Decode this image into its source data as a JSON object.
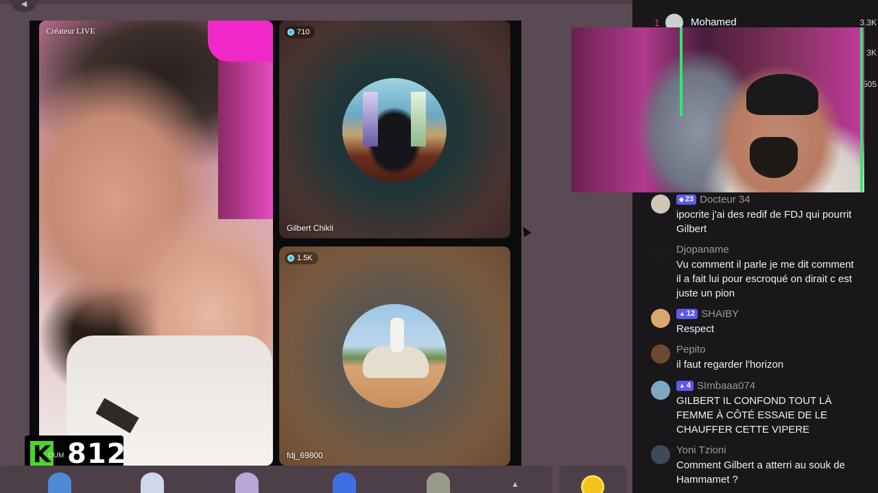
{
  "top": {
    "back_glyph": "◀"
  },
  "grid": {
    "main": {
      "label": "Créateur LIVE"
    },
    "top": {
      "viewers": "710",
      "name": "Gilbert Chikli"
    },
    "bottom": {
      "viewers": "1.5K",
      "name": "fdj_69800"
    }
  },
  "counter": {
    "logo": "K",
    "value": "812",
    "sub": "OUM"
  },
  "chat": {
    "ranking": {
      "rank": "1",
      "name": "Mohamed",
      "value": "3.3K",
      "value2": "3K",
      "value3": "505"
    },
    "messages": [
      {
        "level": "23",
        "badge_symbol": "◆",
        "user": "Docteur 34",
        "text": "ipocrite j'ai des redif de FDJ qui pourrit Gilbert",
        "avatar_color": "#cfc6b8"
      },
      {
        "level": "",
        "badge_symbol": "",
        "user": "Djopaname",
        "text": "Vu comment il parle je me dit comment il a fait lui pour escroqué on dirait c est juste un pion",
        "avatar_color": "#1a181b"
      },
      {
        "level": "12",
        "badge_symbol": "▲",
        "user": "SHAïBY",
        "text": "Respect",
        "avatar_color": "#d9a96b"
      },
      {
        "level": "",
        "badge_symbol": "",
        "user": "Pepito",
        "text": "il faut regarder l'horizon",
        "avatar_color": "#6b4a2f"
      },
      {
        "level": "4",
        "badge_symbol": "▲",
        "user": "SImbaaa074",
        "text": "GILBERT IL CONFOND TOUT LÀ FEMME À CÔTÉ ESSAIE DE LE CHAUFFER CETTE VIPERE",
        "avatar_color": "#7fa6c2"
      },
      {
        "level": "",
        "badge_symbol": "",
        "user": "Yoni Tzioni",
        "text": "Comment Gilbert a atterri au souk de Hammamet ?",
        "avatar_color": "#3c4a5a"
      }
    ]
  },
  "colors": {
    "accent_badge": "#5d5ae8",
    "live_dot": "#29c3e0",
    "k_logo": "#49d62b",
    "rank": "#ff3b4e"
  }
}
